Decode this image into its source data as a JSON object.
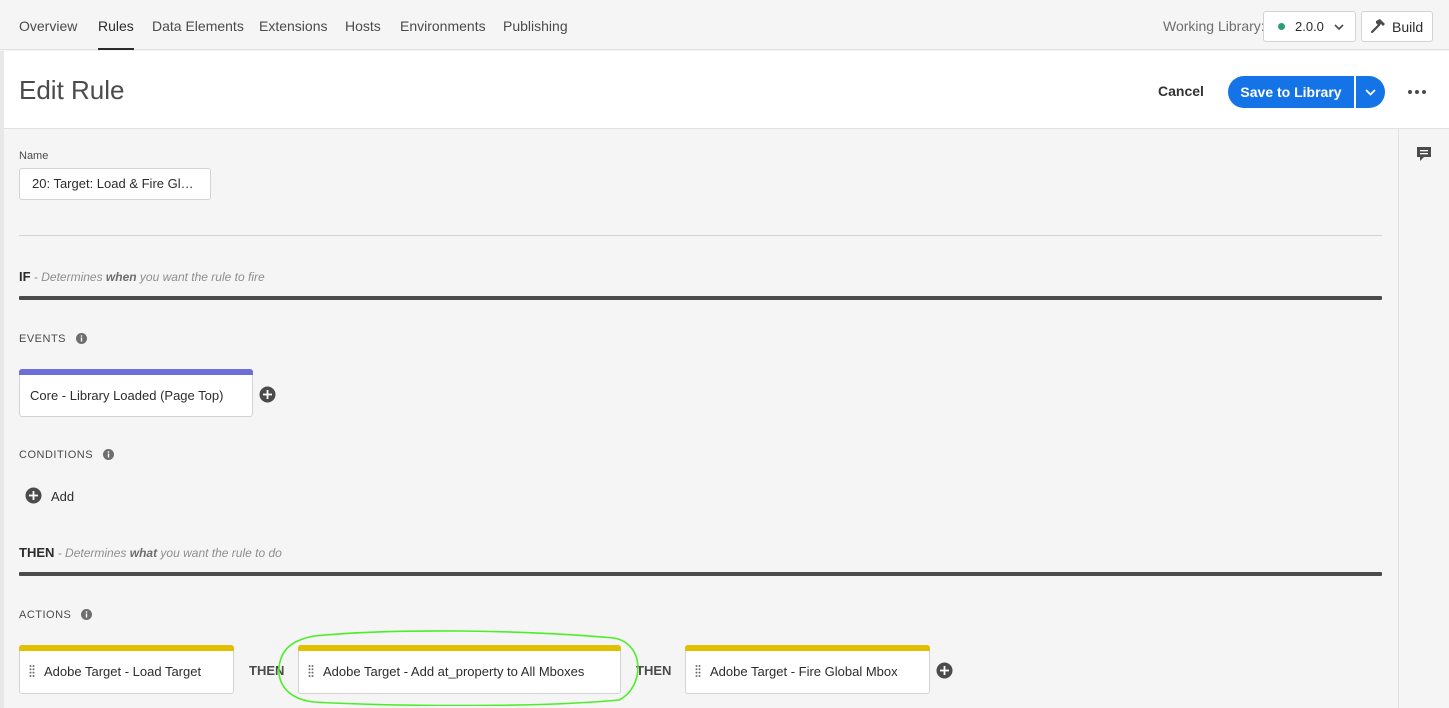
{
  "nav": {
    "tabs": [
      {
        "label": "Overview"
      },
      {
        "label": "Rules"
      },
      {
        "label": "Data Elements"
      },
      {
        "label": "Extensions"
      },
      {
        "label": "Hosts"
      },
      {
        "label": "Environments"
      },
      {
        "label": "Publishing"
      }
    ],
    "active_tab": "Rules",
    "working_library_label": "Working Library:",
    "library_version": "2.0.0",
    "build_label": "Build"
  },
  "header": {
    "title": "Edit Rule",
    "cancel_label": "Cancel",
    "save_label": "Save to Library"
  },
  "form": {
    "name_label": "Name",
    "name_value": "20: Target: Load & Fire Glo..."
  },
  "if_section": {
    "heading": "IF",
    "desc_prefix": " - Determines ",
    "desc_bold": "when",
    "desc_suffix": " you want the rule to fire"
  },
  "events": {
    "label": "EVENTS",
    "items": [
      {
        "label": "Core - Library Loaded (Page Top)"
      }
    ]
  },
  "conditions": {
    "label": "CONDITIONS",
    "add_label": "Add"
  },
  "then_section": {
    "heading": "THEN",
    "desc_prefix": " - Determines ",
    "desc_bold": "what",
    "desc_suffix": " you want the rule to do"
  },
  "actions": {
    "label": "ACTIONS",
    "connector": "THEN",
    "items": [
      {
        "label": "Adobe Target - Load Target"
      },
      {
        "label": "Adobe Target - Add at_property to All Mboxes"
      },
      {
        "label": "Adobe Target - Fire Global Mbox"
      }
    ]
  },
  "colors": {
    "accent_blue": "#1473e6",
    "event_bar": "#6e6ed8",
    "action_bar": "#e0c000",
    "library_status": "#2d9d78",
    "highlight": "#4cee2a"
  },
  "icons": [
    "chevron-down-icon",
    "hammer-icon",
    "more-icon",
    "comment-icon",
    "info-icon",
    "add-circle-icon",
    "drag-handle-icon"
  ]
}
